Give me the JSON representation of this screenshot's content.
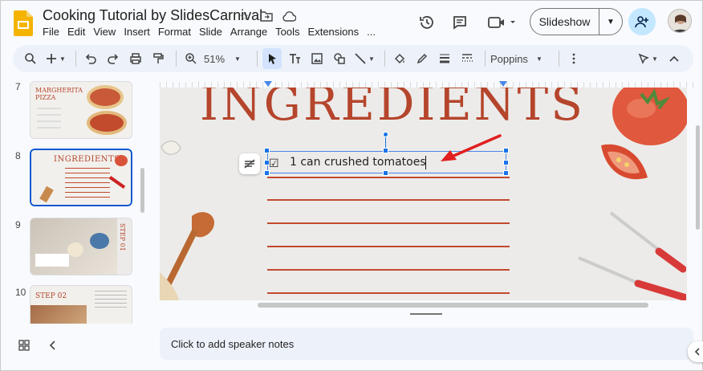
{
  "app": {
    "title": "Cooking Tutorial by SlidesCarnival"
  },
  "menu": [
    "File",
    "Edit",
    "View",
    "Insert",
    "Format",
    "Slide",
    "Arrange",
    "Tools",
    "Extensions",
    "..."
  ],
  "header": {
    "slideshow_label": "Slideshow"
  },
  "toolbar": {
    "zoom": "51%",
    "font": "Poppins"
  },
  "slides": [
    {
      "number": "7",
      "title": "MARGHERITA PIZZA"
    },
    {
      "number": "8",
      "title": "INGREDIENTS"
    },
    {
      "number": "9",
      "title": "STEP 01"
    },
    {
      "number": "10",
      "title": "STEP 02"
    }
  ],
  "slide": {
    "title": "INGREDIENTS",
    "textbox_text": "1 can crushed tomatoes",
    "checkbox": "☑"
  },
  "notes": {
    "placeholder": "Click to add speaker notes"
  },
  "colors": {
    "accent": "#0b57d0",
    "slide_red": "#b5452c",
    "annotation_arrow": "#e02020"
  }
}
